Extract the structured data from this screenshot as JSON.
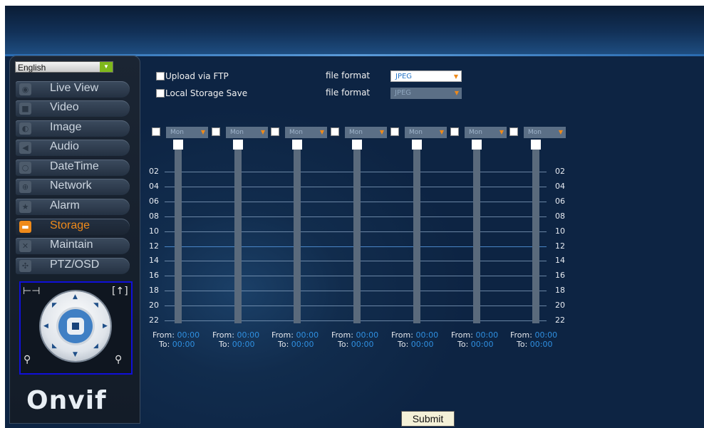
{
  "language": {
    "selected": "English"
  },
  "sidebar": {
    "items": [
      {
        "label": "Live View",
        "icon": "chat-bubble-icon"
      },
      {
        "label": "Video",
        "icon": "camera-icon"
      },
      {
        "label": "Image",
        "icon": "image-icon"
      },
      {
        "label": "Audio",
        "icon": "speaker-icon"
      },
      {
        "label": "DateTime",
        "icon": "clock-icon"
      },
      {
        "label": "Network",
        "icon": "globe-icon"
      },
      {
        "label": "Alarm",
        "icon": "alarm-icon"
      },
      {
        "label": "Storage",
        "icon": "folder-icon",
        "active": true
      },
      {
        "label": "Maintain",
        "icon": "wrench-icon"
      },
      {
        "label": "PTZ/OSD",
        "icon": "ptz-icon"
      }
    ],
    "logo": "nvif"
  },
  "storage": {
    "upload_ftp": {
      "label": "Upload via FTP",
      "checked": false,
      "format_label": "file format",
      "format_value": "JPEG"
    },
    "local_save": {
      "label": "Local Storage Save",
      "checked": false,
      "format_label": "file format",
      "format_value": "JPEG"
    }
  },
  "schedule": {
    "days": [
      {
        "day": "Mon",
        "from": "00:00",
        "to": "00:00"
      },
      {
        "day": "Mon",
        "from": "00:00",
        "to": "00:00"
      },
      {
        "day": "Mon",
        "from": "00:00",
        "to": "00:00"
      },
      {
        "day": "Mon",
        "from": "00:00",
        "to": "00:00"
      },
      {
        "day": "Mon",
        "from": "00:00",
        "to": "00:00"
      },
      {
        "day": "Mon",
        "from": "00:00",
        "to": "00:00"
      },
      {
        "day": "Mon",
        "from": "00:00",
        "to": "00:00"
      }
    ],
    "hours": [
      "02",
      "04",
      "06",
      "08",
      "10",
      "12",
      "14",
      "16",
      "18",
      "20",
      "22"
    ],
    "from_label": "From:",
    "to_label": "To:"
  },
  "submit_label": "Submit",
  "colors": {
    "accent": "#ef8a1a",
    "time_value": "#2f8fe0",
    "background": "#0c2240"
  }
}
